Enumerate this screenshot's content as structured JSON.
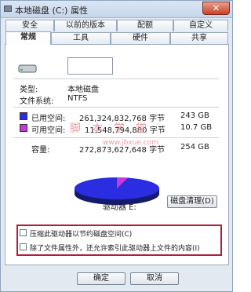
{
  "window": {
    "title": "本地磁盘 (C:) 属性",
    "close_glyph": "✕"
  },
  "tabs": {
    "row1": [
      "安全",
      "以前的版本",
      "配额",
      "自定义"
    ],
    "row2": [
      "常规",
      "工具",
      "硬件",
      "共享"
    ],
    "active": "常规"
  },
  "general": {
    "type_label": "类型:",
    "type_value": "本地磁盘",
    "fs_label": "文件系统:",
    "fs_value": "NTFS",
    "used_label": "已用空间:",
    "used_bytes": "261,324,832,768 字节",
    "used_size": "243 GB",
    "free_label": "可用空间:",
    "free_bytes": "11,548,794,880 字节",
    "free_size": "10.7 GB",
    "capacity_label": "容量:",
    "capacity_bytes": "272,873,627,648 字节",
    "capacity_size": "254 GB",
    "drive_label": "驱动器 E:",
    "cleanup_label": "磁盘清理(D)",
    "used_fraction": 0.958
  },
  "options": {
    "compress_label": "压缩此驱动器以节约磁盘空间(C)",
    "index_label": "除了文件属性外，还允许索引此驱动器上文件的内容(I)"
  },
  "footer": {
    "ok_label": "确定",
    "cancel_label": "取消"
  },
  "watermark": {
    "text": "脚本学堂",
    "url": "www.jbxue.com"
  },
  "colors": {
    "used": "#2a2ee0",
    "free": "#c43bd8",
    "highlight": "#b01e3a"
  }
}
